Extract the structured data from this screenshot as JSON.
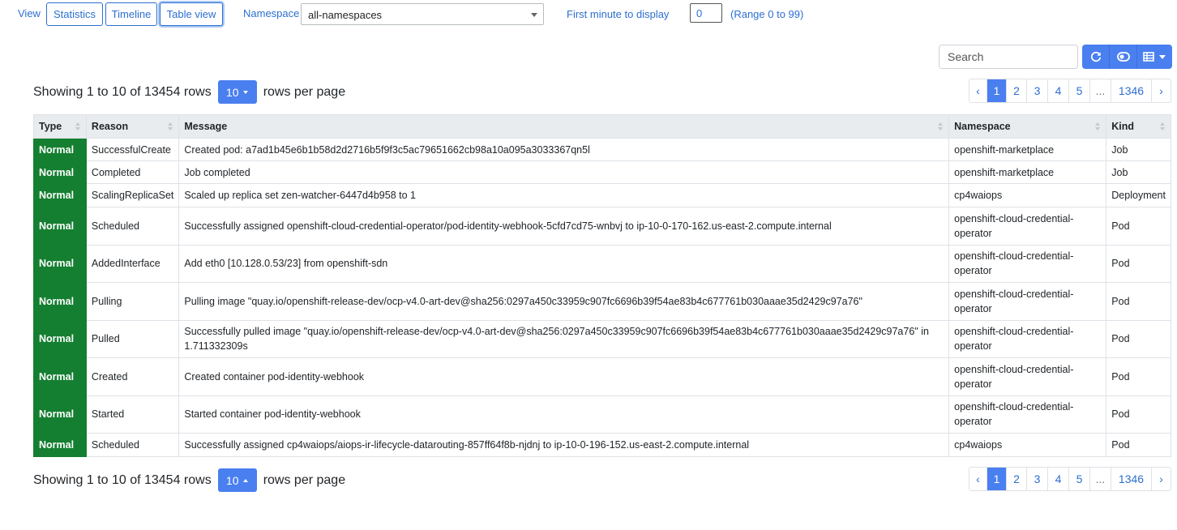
{
  "toolbar": {
    "view_label": "View",
    "view_buttons": [
      "Statistics",
      "Timeline",
      "Table view"
    ],
    "namespace_label": "Namespace",
    "namespace_value": "all-namespaces",
    "first_minute_label": "First minute to display",
    "first_minute_value": "0",
    "range_text": "(Range 0 to 99)"
  },
  "search": {
    "placeholder": "Search"
  },
  "icons": [
    "refresh-icon",
    "toggle-icon",
    "columns-icon"
  ],
  "accent_color": "#4a7ff0",
  "status_color": "#157f31",
  "summary": {
    "prefix": "Showing 1 to 10 of 13454 rows",
    "per_page": "10",
    "suffix": "rows per page"
  },
  "pagination": {
    "prev": "‹",
    "pages": [
      "1",
      "2",
      "3",
      "4",
      "5"
    ],
    "ellipsis": "...",
    "last": "1346",
    "next": "›"
  },
  "table": {
    "headers": [
      "Type",
      "Reason",
      "Message",
      "Namespace",
      "Kind"
    ],
    "rows": [
      {
        "type": "Normal",
        "reason": "SuccessfulCreate",
        "message": "Created pod: a7ad1b45e6b1b58d2d2716b5f9f3c5ac79651662cb98a10a095a3033367qn5l",
        "namespace": "openshift-marketplace",
        "kind": "Job"
      },
      {
        "type": "Normal",
        "reason": "Completed",
        "message": "Job completed",
        "namespace": "openshift-marketplace",
        "kind": "Job"
      },
      {
        "type": "Normal",
        "reason": "ScalingReplicaSet",
        "message": "Scaled up replica set zen-watcher-6447d4b958 to 1",
        "namespace": "cp4waiops",
        "kind": "Deployment"
      },
      {
        "type": "Normal",
        "reason": "Scheduled",
        "message": "Successfully assigned openshift-cloud-credential-operator/pod-identity-webhook-5cfd7cd75-wnbvj to ip-10-0-170-162.us-east-2.compute.internal",
        "namespace": "openshift-cloud-credential-operator",
        "kind": "Pod"
      },
      {
        "type": "Normal",
        "reason": "AddedInterface",
        "message": "Add eth0 [10.128.0.53/23] from openshift-sdn",
        "namespace": "openshift-cloud-credential-operator",
        "kind": "Pod"
      },
      {
        "type": "Normal",
        "reason": "Pulling",
        "message": "Pulling image \"quay.io/openshift-release-dev/ocp-v4.0-art-dev@sha256:0297a450c33959c907fc6696b39f54ae83b4c677761b030aaae35d2429c97a76\"",
        "namespace": "openshift-cloud-credential-operator",
        "kind": "Pod"
      },
      {
        "type": "Normal",
        "reason": "Pulled",
        "message": "Successfully pulled image \"quay.io/openshift-release-dev/ocp-v4.0-art-dev@sha256:0297a450c33959c907fc6696b39f54ae83b4c677761b030aaae35d2429c97a76\" in 1.711332309s",
        "namespace": "openshift-cloud-credential-operator",
        "kind": "Pod"
      },
      {
        "type": "Normal",
        "reason": "Created",
        "message": "Created container pod-identity-webhook",
        "namespace": "openshift-cloud-credential-operator",
        "kind": "Pod"
      },
      {
        "type": "Normal",
        "reason": "Started",
        "message": "Started container pod-identity-webhook",
        "namespace": "openshift-cloud-credential-operator",
        "kind": "Pod"
      },
      {
        "type": "Normal",
        "reason": "Scheduled",
        "message": "Successfully assigned cp4waiops/aiops-ir-lifecycle-datarouting-857ff64f8b-njdnj to ip-10-0-196-152.us-east-2.compute.internal",
        "namespace": "cp4waiops",
        "kind": "Pod"
      }
    ]
  }
}
